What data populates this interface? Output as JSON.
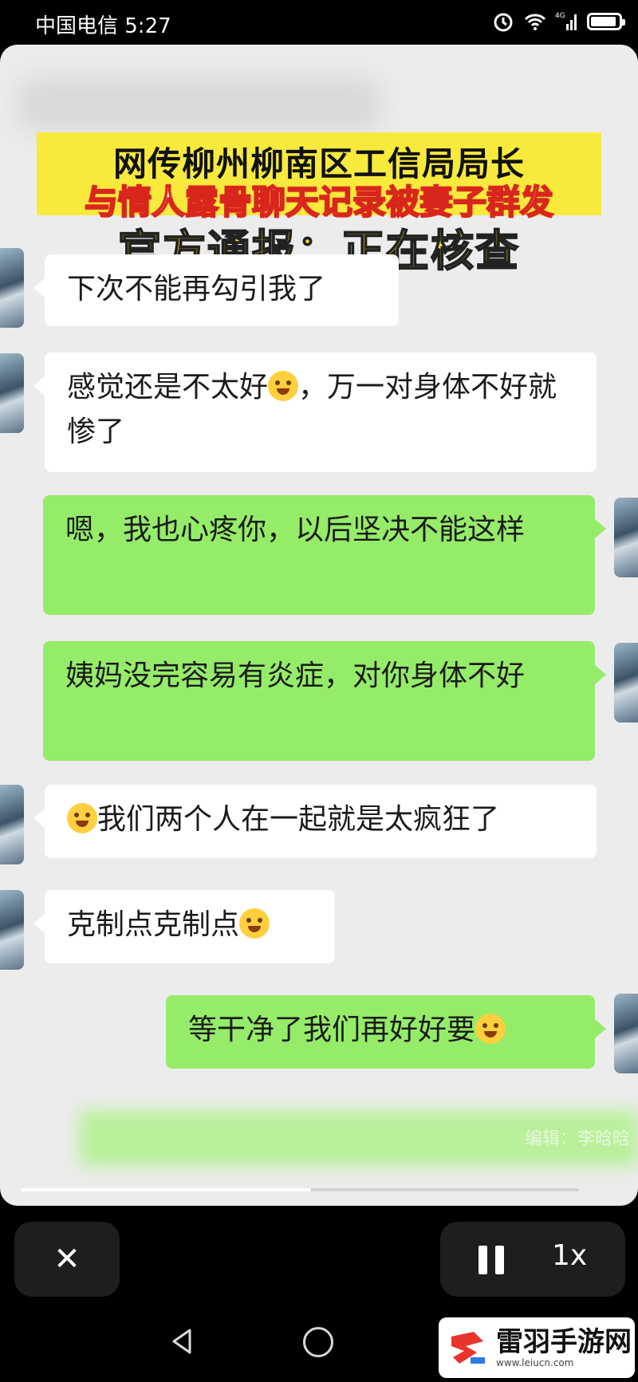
{
  "status_bar": {
    "carrier_time": "中国电信 5:27",
    "network": "4G",
    "icons": [
      "alarm-icon",
      "wifi-icon",
      "signal-icon",
      "battery-icon"
    ],
    "battery_level": 0.9
  },
  "video": {
    "banner_line1": "网传柳州柳南区工信局局长",
    "banner_line2": "与情人露骨聊天记录被妻子群发",
    "notice": "官方通报：正在核查",
    "messages": [
      {
        "side": "in",
        "text": "下次不能再勾引我了"
      },
      {
        "side": "in",
        "text": "感觉还是不太好",
        "emoji": "laughing-tears-emoji",
        "text_after": "，万一对身体不好就惨了"
      },
      {
        "side": "out",
        "text": "嗯，我也心疼你，以后坚决不能这样"
      },
      {
        "side": "out",
        "text": "姨妈没完容易有炎症，对你身体不好"
      },
      {
        "side": "in",
        "emoji": "sick-emoji",
        "text": "我们两个人在一起就是太疯狂了"
      },
      {
        "side": "in",
        "text": "克制点克制点",
        "emoji": "dizzy-emoji"
      },
      {
        "side": "out",
        "text": "等干净了我们再好好要",
        "emoji": "wink-emoji"
      }
    ],
    "editor_credit": "编辑：李晗晗",
    "progress": 0.52
  },
  "controls": {
    "close_label": "✕",
    "speed_label": "1x"
  },
  "watermark": {
    "title": "雷羽手游网",
    "url": "www.leiucn.com"
  }
}
